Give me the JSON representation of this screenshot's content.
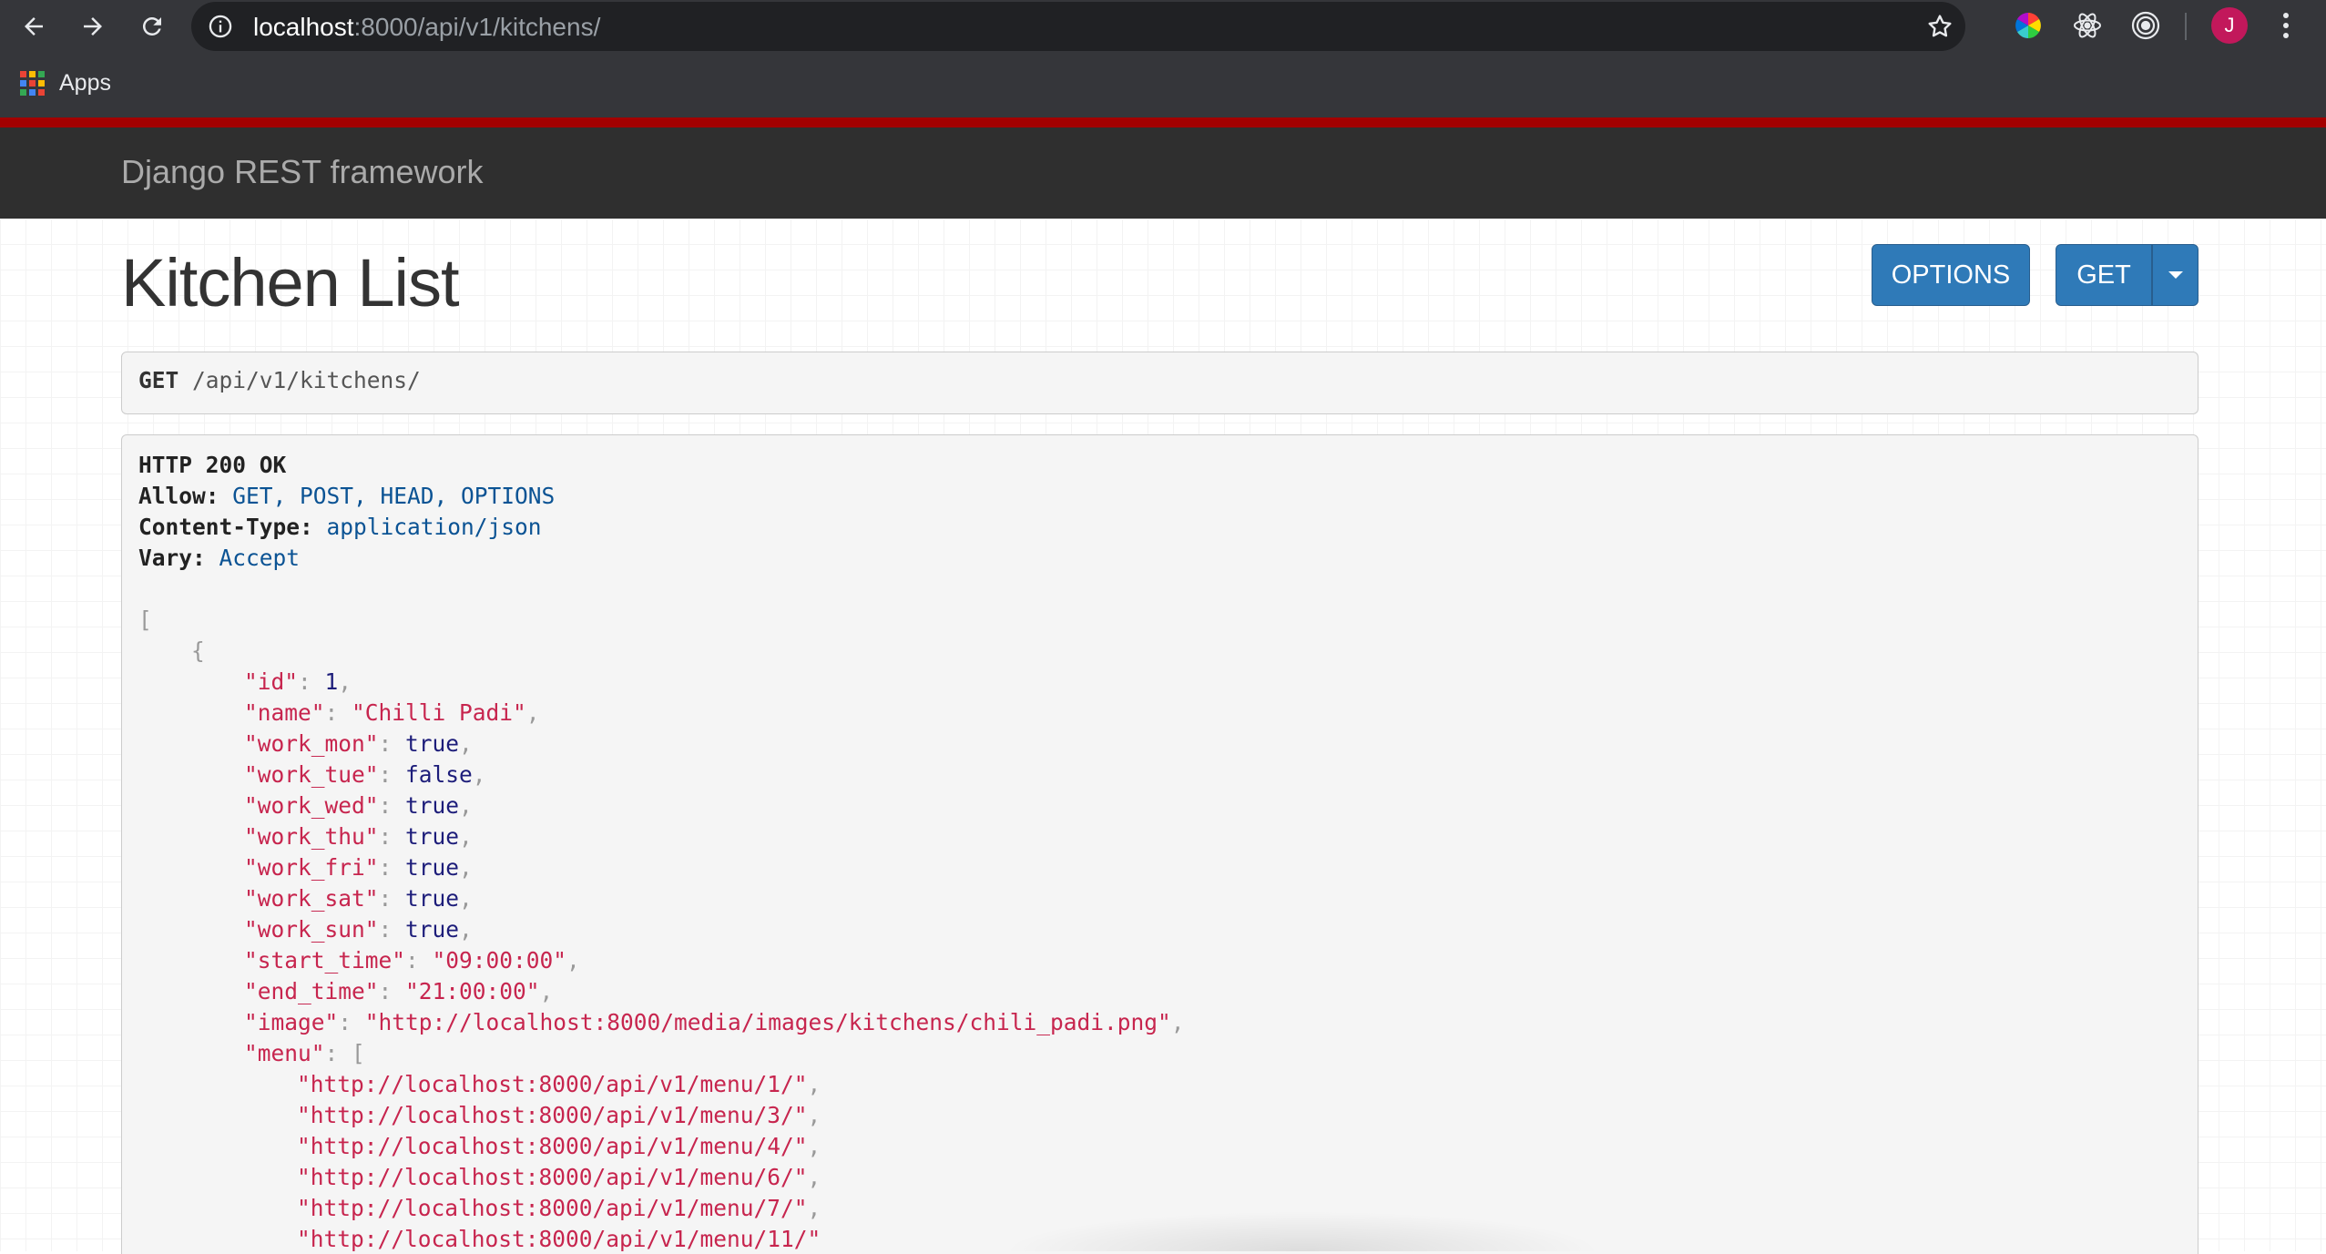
{
  "browser": {
    "url_host": "localhost",
    "url_rest": ":8000/api/v1/kitchens/",
    "bookmarks_apps_label": "Apps",
    "avatar_initial": "J"
  },
  "drf": {
    "brand": "Django REST framework",
    "page_title": "Kitchen List",
    "buttons": {
      "options": "OPTIONS",
      "get": "GET"
    },
    "request": {
      "method": "GET",
      "path": "/api/v1/kitchens/"
    },
    "response": {
      "status": "HTTP 200 OK",
      "headers": [
        {
          "name": "Allow:",
          "value": "GET, POST, HEAD, OPTIONS"
        },
        {
          "name": "Content-Type:",
          "value": "application/json"
        },
        {
          "name": "Vary:",
          "value": "Accept"
        }
      ],
      "fields": {
        "id": "\"id\"",
        "id_val": "1",
        "name": "\"name\"",
        "name_val": "\"Chilli Padi\"",
        "work_mon": "\"work_mon\"",
        "work_mon_val": "true",
        "work_tue": "\"work_tue\"",
        "work_tue_val": "false",
        "work_wed": "\"work_wed\"",
        "work_wed_val": "true",
        "work_thu": "\"work_thu\"",
        "work_thu_val": "true",
        "work_fri": "\"work_fri\"",
        "work_fri_val": "true",
        "work_sat": "\"work_sat\"",
        "work_sat_val": "true",
        "work_sun": "\"work_sun\"",
        "work_sun_val": "true",
        "start_time": "\"start_time\"",
        "start_time_val": "\"09:00:00\"",
        "end_time": "\"end_time\"",
        "end_time_val": "\"21:00:00\"",
        "image": "\"image\"",
        "image_val": "\"http://localhost:8000/media/images/kitchens/chili_padi.png\"",
        "menu": "\"menu\""
      },
      "menu_items": [
        "\"http://localhost:8000/api/v1/menu/1/\"",
        "\"http://localhost:8000/api/v1/menu/3/\"",
        "\"http://localhost:8000/api/v1/menu/4/\"",
        "\"http://localhost:8000/api/v1/menu/6/\"",
        "\"http://localhost:8000/api/v1/menu/7/\"",
        "\"http://localhost:8000/api/v1/menu/11/\""
      ]
    }
  },
  "colors": {
    "primary_button": "#2f7ab8",
    "navbar": "#2f2f2f",
    "navbar_accent": "#a30000",
    "json_string": "#c7254e"
  }
}
